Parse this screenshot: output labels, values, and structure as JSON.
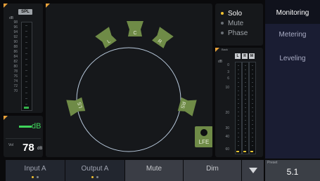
{
  "spl": {
    "label": "SPL",
    "unit": "dB",
    "scale": [
      "98",
      "96",
      "94",
      "92",
      "90",
      "88",
      "86",
      "84",
      "82",
      "80",
      "78",
      "76",
      "74",
      "72",
      "70"
    ]
  },
  "level": {
    "unit": "dB",
    "vol_label": "Vol",
    "vol_value": "78",
    "vol_unit": "dB"
  },
  "speakers": {
    "L": "L",
    "C": "C",
    "R": "R",
    "LS": "LS",
    "RS": "RS",
    "LFE": "LFE"
  },
  "state": {
    "solo": "Solo",
    "mute": "Mute",
    "phase": "Phase"
  },
  "meters": {
    "label": "Back",
    "unit": "dB",
    "headers": [
      "L",
      "R",
      "M"
    ],
    "scale": [
      "0",
      "3",
      "6",
      "10",
      "20",
      "30",
      "40",
      "60"
    ]
  },
  "tabs": {
    "monitoring": "Monitoring",
    "metering": "Metering",
    "leveling": "Leveling"
  },
  "bottom": {
    "input": "Input A",
    "output": "Output A",
    "mute": "Mute",
    "dim": "Dim"
  },
  "preset": {
    "label": "Preset",
    "value": "5.1"
  },
  "colors": {
    "accent_orange": "#e8a13a",
    "speaker_green": "#6f8b47",
    "solo_yellow": "#f2c230",
    "level_green": "#3fd45a",
    "tab_blue": "#1a1d33"
  }
}
